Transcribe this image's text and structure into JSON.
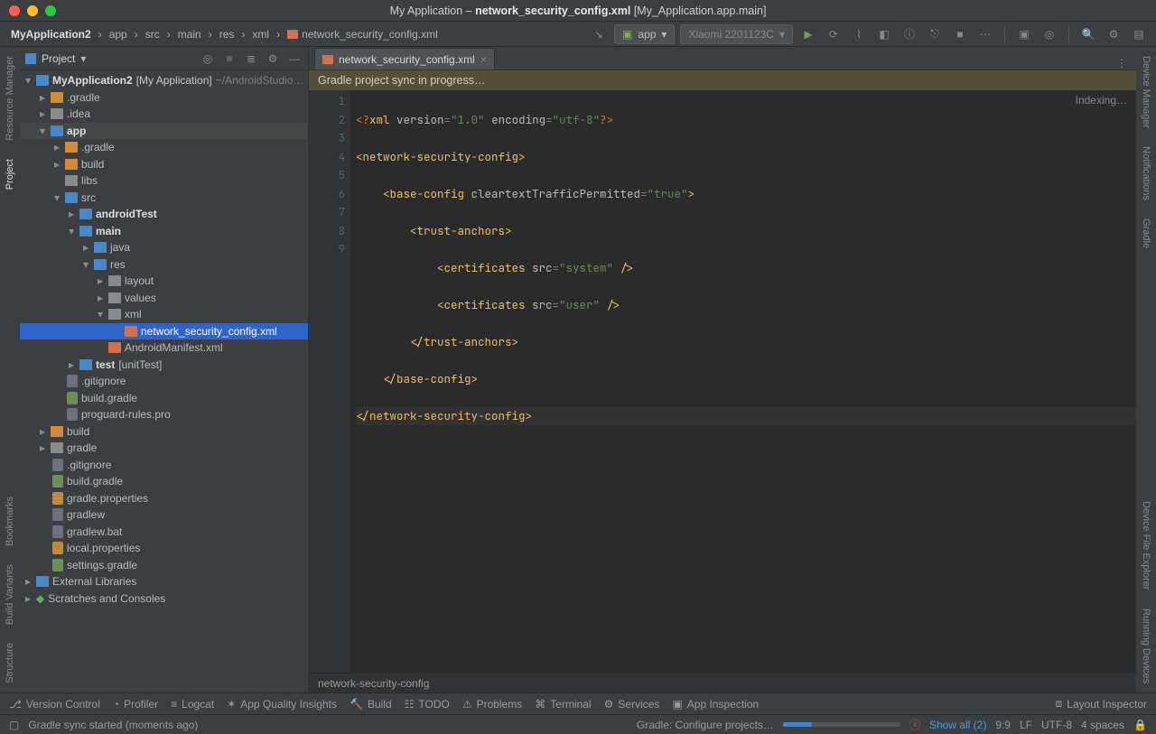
{
  "window": {
    "title_prefix": "My Application – ",
    "title_file": "network_security_config.xml",
    "title_suffix": " [My_Application.app.main]"
  },
  "breadcrumbs": [
    "MyApplication2",
    "app",
    "src",
    "main",
    "res",
    "xml",
    "network_security_config.xml"
  ],
  "run_config": {
    "module": "app",
    "device": "Xiaomi 2201123C"
  },
  "sidebar": {
    "view_name": "Project",
    "root_name": "MyApplication2",
    "root_hint": "[My Application]",
    "root_path": "~/AndroidStudio…",
    "items": {
      "gradle_dir": ".gradle",
      "idea_dir": ".idea",
      "app": "app",
      "app_gradle": ".gradle",
      "app_build": "build",
      "libs": "libs",
      "src": "src",
      "androidTest": "androidTest",
      "main": "main",
      "java": "java",
      "res": "res",
      "layout": "layout",
      "values": "values",
      "xml": "xml",
      "nsc": "network_security_config.xml",
      "manifest": "AndroidManifest.xml",
      "test": "test",
      "test_hint": "[unitTest]",
      "gitignore": ".gitignore",
      "build_gradle": "build.gradle",
      "proguard": "proguard-rules.pro",
      "build": "build",
      "gradle": "gradle",
      "root_gitignore": ".gitignore",
      "root_build_gradle": "build.gradle",
      "gradle_props": "gradle.properties",
      "gradlew": "gradlew",
      "gradlew_bat": "gradlew.bat",
      "local_props": "local.properties",
      "settings_gradle": "settings.gradle",
      "ext_libs": "External Libraries",
      "scratches": "Scratches and Consoles"
    }
  },
  "tab": {
    "label": "network_security_config.xml"
  },
  "banner": "Gradle project sync in progress…",
  "indexing_hint": "Indexing…",
  "code": {
    "lines": [
      1,
      2,
      3,
      4,
      5,
      6,
      7,
      8,
      9
    ],
    "l1": {
      "a": "<?",
      "b": "xml ",
      "c": "version",
      "d": "=\"1.0\"",
      "e": " encoding",
      "f": "=\"utf-8\"",
      "g": "?>"
    },
    "l2": "<network-security-config>",
    "l3": {
      "a": "    <",
      "b": "base-config ",
      "c": "cleartextTrafficPermitted",
      "d": "=\"true\"",
      "e": ">"
    },
    "l4": "        <trust-anchors>",
    "l5": {
      "a": "            <",
      "b": "certificates ",
      "c": "src",
      "d": "=\"system\"",
      "e": " />"
    },
    "l6": {
      "a": "            <",
      "b": "certificates ",
      "c": "src",
      "d": "=\"user\"",
      "e": " />"
    },
    "l7": "        </trust-anchors>",
    "l8": "    </base-config>",
    "l9": "</network-security-config>"
  },
  "editor_breadcrumb": "network-security-config",
  "bottom_tools": {
    "vcs": "Version Control",
    "profiler": "Profiler",
    "logcat": "Logcat",
    "aqi": "App Quality Insights",
    "build": "Build",
    "todo": "TODO",
    "problems": "Problems",
    "terminal": "Terminal",
    "services": "Services",
    "appinsp": "App Inspection",
    "layoutinsp": "Layout Inspector"
  },
  "status": {
    "sync_msg": "Gradle sync started (moments ago)",
    "gradle_task": "Gradle: Configure projects…",
    "show_all": "Show all (2)",
    "caret": "9:9",
    "line_sep": "LF",
    "encoding": "UTF-8",
    "indent": "4 spaces"
  },
  "left_gutter": [
    "Resource Manager",
    "Project",
    "Bookmarks",
    "Build Variants",
    "Structure"
  ],
  "right_gutter": [
    "Device Manager",
    "Notifications",
    "Gradle",
    "Device File Explorer",
    "Running Devices"
  ]
}
